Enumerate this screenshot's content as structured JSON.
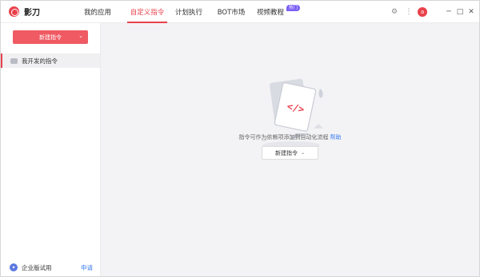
{
  "app": {
    "name": "影刀"
  },
  "nav": {
    "items": [
      {
        "label": "我的应用",
        "active": false
      },
      {
        "label": "自定义指令",
        "active": true
      },
      {
        "label": "计划执行",
        "active": false
      },
      {
        "label": "BOT市场",
        "active": false
      },
      {
        "label": "视频教程",
        "active": false,
        "badge": "热门"
      }
    ]
  },
  "titlebar": {
    "icons": [
      "settings-icon",
      "more-icon",
      "avatar",
      "minimize-icon",
      "maximize-icon",
      "close-icon"
    ],
    "avatar_text": "a"
  },
  "sidebar": {
    "new_button": "新建指令",
    "items": [
      {
        "label": "我开发的指令"
      }
    ],
    "footer": {
      "label": "企业版试用",
      "action": "申请"
    }
  },
  "main": {
    "hint": "指令可作为依赖项添加到自动化流程",
    "help": "帮助",
    "new_button": "新建指令"
  },
  "colors": {
    "accent": "#e9414b",
    "link": "#3a7bf0",
    "badge": "#7b5ff5"
  }
}
